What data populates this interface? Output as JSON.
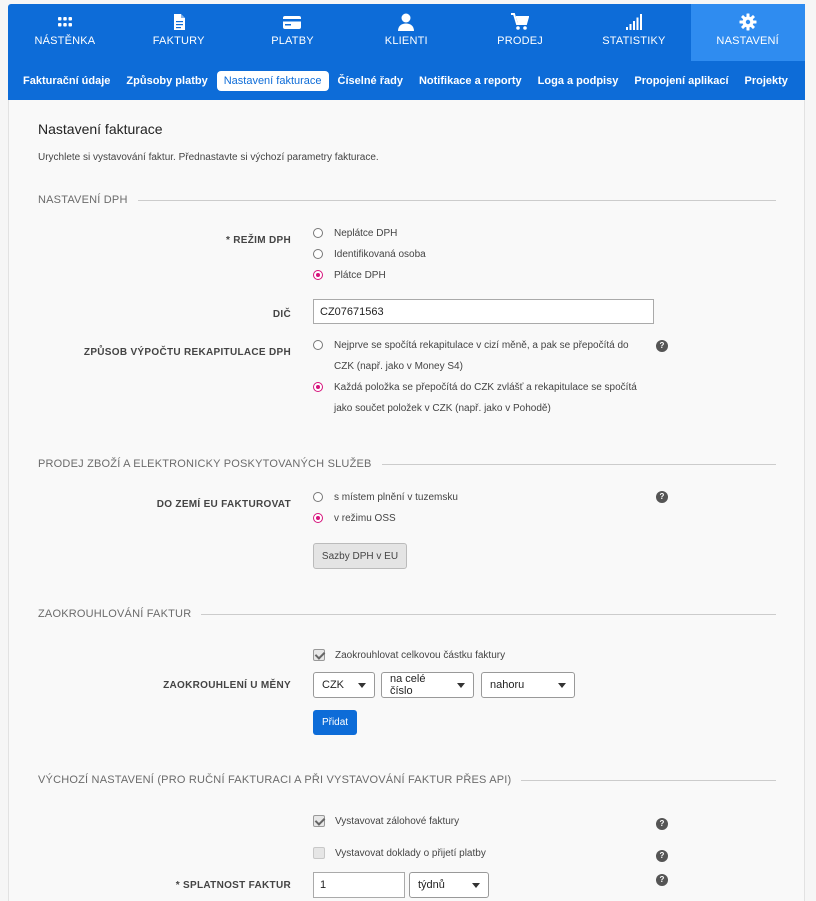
{
  "nav": {
    "items": [
      {
        "label": "NÁSTĚNKA",
        "icon": "dashboard-grid-icon"
      },
      {
        "label": "FAKTURY",
        "icon": "invoice-document-icon"
      },
      {
        "label": "PLATBY",
        "icon": "credit-card-icon"
      },
      {
        "label": "KLIENTI",
        "icon": "user-icon"
      },
      {
        "label": "PRODEJ",
        "icon": "shopping-cart-icon"
      },
      {
        "label": "STATISTIKY",
        "icon": "signal-bars-icon"
      },
      {
        "label": "NASTAVENÍ",
        "icon": "gear-icon"
      }
    ],
    "active_index": 6
  },
  "subnav": {
    "items": [
      "Fakturační údaje",
      "Způsoby platby",
      "Nastavení fakturace",
      "Číselné řady",
      "Notifikace a reporty",
      "Loga a podpisy",
      "Propojení aplikací",
      "Projekty"
    ],
    "active_index": 2
  },
  "page": {
    "title": "Nastavení fakturace",
    "description": "Urychlete si vystavování faktur. Přednastavte si výchozí parametry fakturace."
  },
  "vat": {
    "heading": "NASTAVENÍ DPH",
    "mode_label": "* REŽIM DPH",
    "mode_options": [
      "Neplátce DPH",
      "Identifikovaná osoba",
      "Plátce DPH"
    ],
    "mode_selected": 2,
    "dic_label": "DIČ",
    "dic_value": "CZ07671563",
    "calc_label": "ZPŮSOB VÝPOČTU REKAPITULACE DPH",
    "calc_option_1_line_1": "Nejprve se spočítá rekapitulace v cizí měně, a pak se přepočítá do",
    "calc_option_1_line_2": "CZK (např. jako v Money S4)",
    "calc_option_2_line_1": "Každá položka se přepočítá do CZK zvlášť a rekapitulace se spočítá",
    "calc_option_2_line_2": "jako součet položek v CZK (např. jako v Pohodě)",
    "calc_selected": 2
  },
  "eu": {
    "heading": "PRODEJ ZBOŽÍ A ELEKTRONICKY POSKYTOVANÝCH SLUŽEB",
    "label": "DO ZEMÍ EU FAKTUROVAT",
    "options": [
      "s místem plnění v tuzemsku",
      "v režimu OSS"
    ],
    "selected": 1,
    "rates_button": "Sazby DPH v EU"
  },
  "rounding": {
    "heading": "ZAOKROUHLOVÁNÍ FAKTUR",
    "checkbox_label": "Zaokrouhlovat celkovou částku faktury",
    "checked": true,
    "label": "ZAOKROUHLENÍ U MĚNY",
    "currency": "CZK",
    "precision": "na celé číslo",
    "direction": "nahoru",
    "add_button": "Přidat"
  },
  "defaults": {
    "heading": "VÝCHOZÍ NASTAVENÍ (PRO RUČNÍ FAKTURACI A PŘI VYSTAVOVÁNÍ FAKTUR PŘES API)",
    "proforma_label": "Vystavovat zálohové faktury",
    "proforma_checked": true,
    "receipt_label": "Vystavovat doklady o přijetí platby",
    "receipt_checked": false,
    "due_label": "* SPLATNOST FAKTUR",
    "due_value": "1",
    "due_unit": "týdnů"
  },
  "help_mark": "?"
}
